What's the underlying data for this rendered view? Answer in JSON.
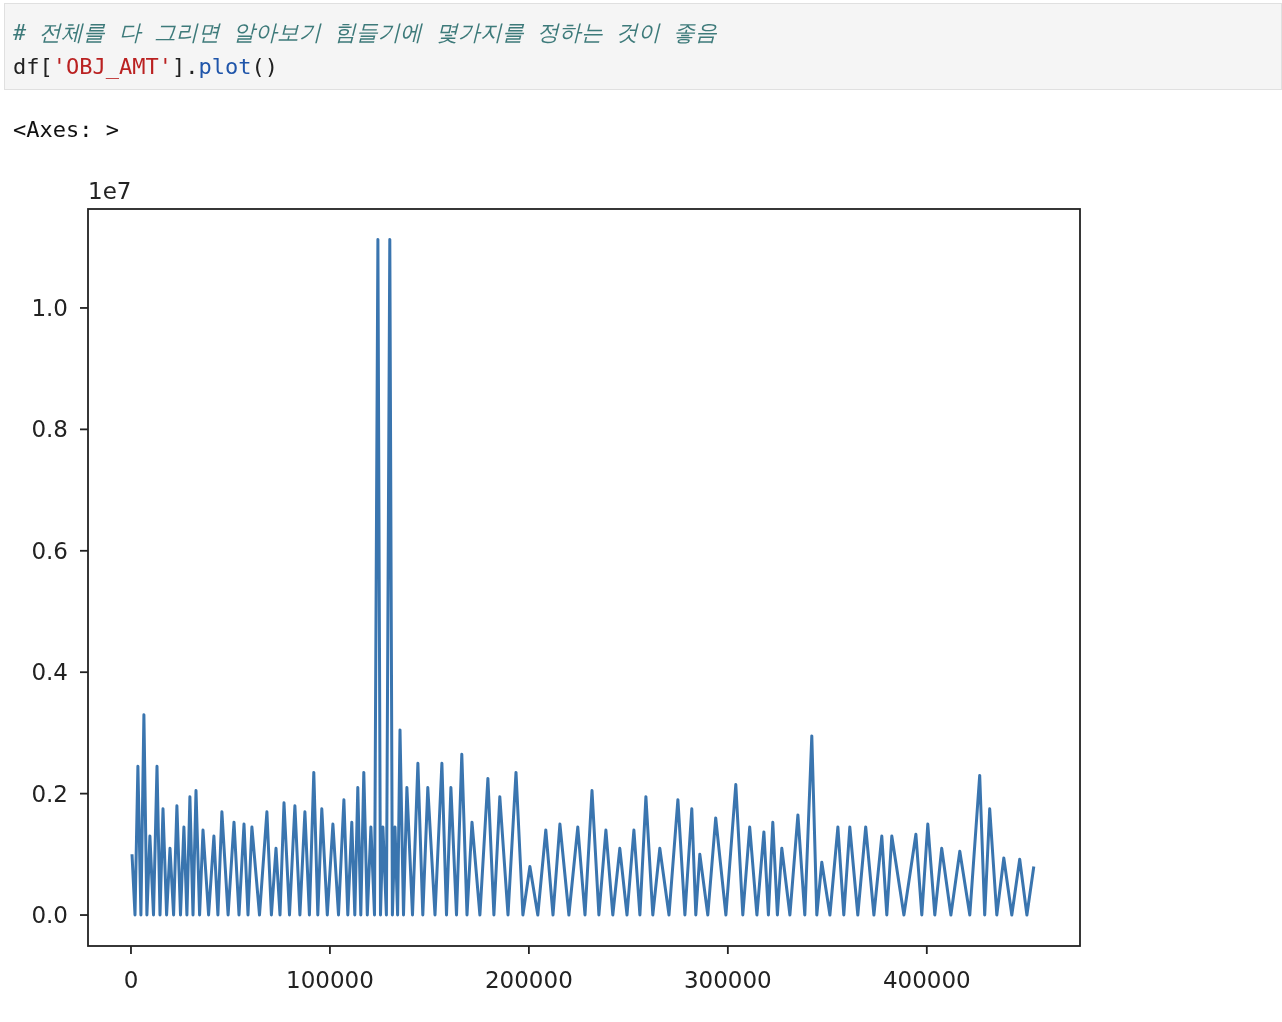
{
  "cell": {
    "code_lines": [
      [
        {
          "kind": "comment",
          "text": "# 전체를 다 그리면 알아보기 힘들기에 몇가지를 정하는 것이 좋음"
        }
      ],
      [
        {
          "kind": "plain",
          "text": "df["
        },
        {
          "kind": "string",
          "text": "'OBJ_AMT'"
        },
        {
          "kind": "plain",
          "text": "]."
        },
        {
          "kind": "name",
          "text": "plot"
        },
        {
          "kind": "plain",
          "text": "()"
        }
      ]
    ]
  },
  "output": {
    "text": "<Axes: >",
    "plot": {
      "offset_label": "1e7",
      "chart_data": {
        "type": "line",
        "x": [
          500,
          2000,
          3500,
          5000,
          6500,
          8000,
          9500,
          11300,
          13100,
          14600,
          16100,
          17900,
          19600,
          21400,
          23100,
          24900,
          26600,
          28100,
          29600,
          31200,
          32700,
          34500,
          36200,
          39000,
          41700,
          43700,
          45700,
          48800,
          51800,
          54300,
          56800,
          58800,
          60800,
          64600,
          68300,
          70600,
          72900,
          74900,
          76900,
          79700,
          82400,
          84900,
          87400,
          89700,
          91900,
          93900,
          95900,
          98700,
          101500,
          104300,
          107000,
          109000,
          111000,
          112500,
          114000,
          115500,
          117000,
          118800,
          120600,
          122400,
          124100,
          125400,
          126600,
          128400,
          130100,
          131400,
          132700,
          134000,
          135200,
          137000,
          138700,
          141500,
          144200,
          146700,
          149200,
          152800,
          156300,
          158600,
          160800,
          163600,
          166300,
          168900,
          171400,
          175400,
          179400,
          182400,
          185400,
          189500,
          193500,
          197000,
          200500,
          204500,
          208500,
          212100,
          215600,
          220100,
          224600,
          228200,
          231700,
          235200,
          238700,
          242200,
          245700,
          249300,
          252800,
          255800,
          258800,
          262300,
          265800,
          270400,
          274900,
          278400,
          281900,
          283900,
          285900,
          289900,
          293900,
          299000,
          304000,
          307500,
          311000,
          314600,
          318100,
          320400,
          322600,
          324900,
          327100,
          331200,
          335200,
          338700,
          342200,
          344700,
          347200,
          351300,
          355300,
          358300,
          361300,
          365300,
          369300,
          373400,
          377400,
          379900,
          382400,
          388500,
          394500,
          397500,
          400500,
          404000,
          407500,
          412100,
          416600,
          421600,
          426600,
          429100,
          431600,
          435200,
          438700,
          442700,
          446700,
          450300,
          453800
        ],
        "series": [
          {
            "color": "#3a75af",
            "values": [
              0.1,
              0,
              0.245,
              0,
              0.33,
              0,
              0.13,
              0,
              0.245,
              0,
              0.175,
              0,
              0.11,
              0,
              0.18,
              0,
              0.145,
              0,
              0.195,
              0,
              0.205,
              0,
              0.14,
              0,
              0.13,
              0,
              0.17,
              0,
              0.153,
              0,
              0.15,
              0,
              0.145,
              0,
              0.17,
              0,
              0.11,
              0,
              0.185,
              0,
              0.18,
              0,
              0.17,
              0,
              0.235,
              0,
              0.175,
              0,
              0.15,
              0,
              0.19,
              0,
              0.153,
              0,
              0.21,
              0,
              0.235,
              0,
              0.145,
              0,
              1.113,
              0,
              0.145,
              0,
              1.113,
              0,
              0.145,
              0,
              0.305,
              0,
              0.21,
              0,
              0.25,
              0,
              0.21,
              0,
              0.25,
              0,
              0.21,
              0,
              0.265,
              0,
              0.153,
              0,
              0.225,
              0,
              0.195,
              0,
              0.235,
              0,
              0.08,
              0,
              0.14,
              0,
              0.15,
              0,
              0.145,
              0,
              0.205,
              0,
              0.14,
              0,
              0.11,
              0,
              0.14,
              0,
              0.195,
              0,
              0.11,
              0,
              0.19,
              0,
              0.175,
              0,
              0.1,
              0,
              0.16,
              0,
              0.215,
              0,
              0.145,
              0,
              0.137,
              0,
              0.153,
              0,
              0.11,
              0,
              0.165,
              0,
              0.295,
              0,
              0.087,
              0,
              0.145,
              0,
              0.145,
              0,
              0.145,
              0,
              0.13,
              0,
              0.13,
              0,
              0.133,
              0,
              0.15,
              0,
              0.11,
              0,
              0.105,
              0,
              0.23,
              0,
              0.175,
              0,
              0.094,
              0,
              0.092,
              0,
              0.08
            ]
          }
        ],
        "xlim": [
          -21600,
          477000
        ],
        "ylim": [
          -0.051,
          1.163
        ],
        "xticks": [
          0,
          100000,
          200000,
          300000,
          400000
        ],
        "yticks": [
          {
            "value": 0,
            "label": "0.0"
          },
          {
            "value": 0.2,
            "label": "0.2"
          },
          {
            "value": 0.4,
            "label": "0.4"
          },
          {
            "value": 0.6,
            "label": "0.6"
          },
          {
            "value": 0.8,
            "label": "0.8"
          },
          {
            "value": 1.0,
            "label": "1.0"
          }
        ]
      }
    }
  }
}
